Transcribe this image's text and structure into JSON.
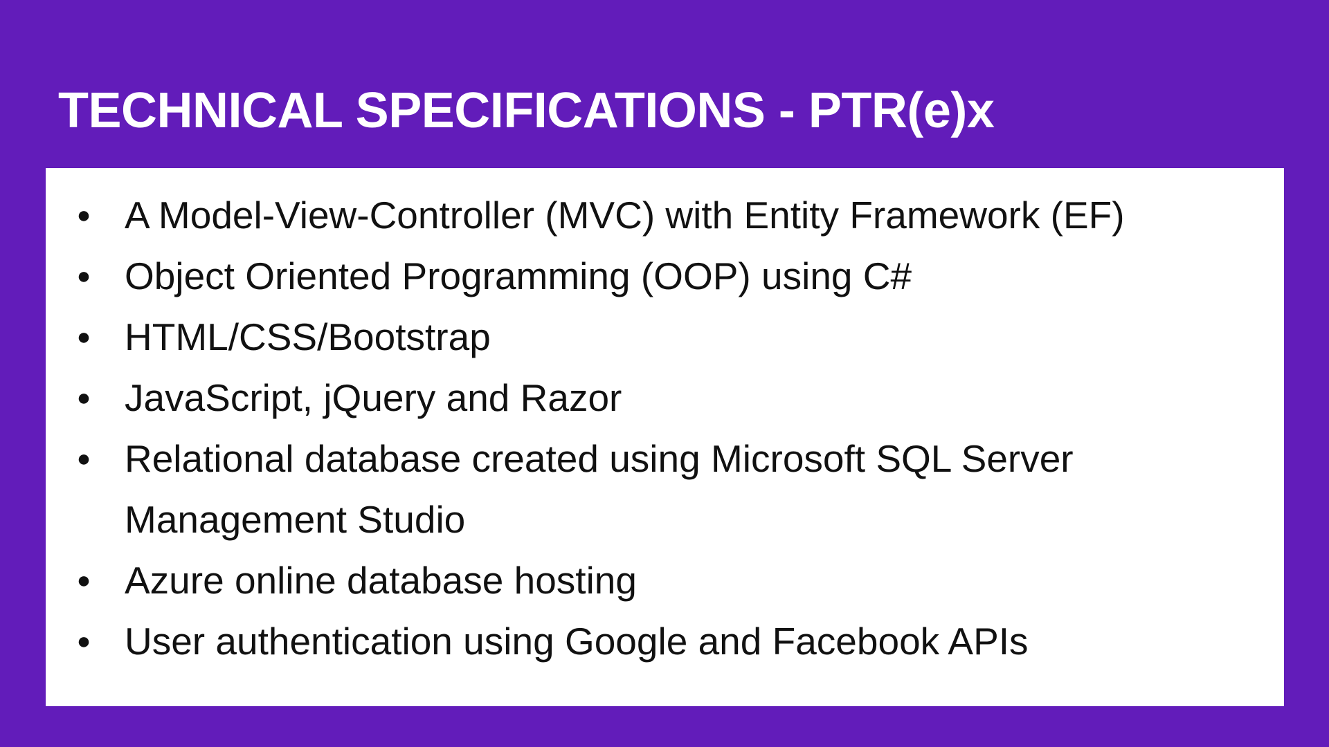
{
  "slide": {
    "title": "TECHNICAL SPECIFICATIONS - PTR(e)x",
    "bullet_glyph": "●",
    "items": [
      {
        "text": "A Model-View-Controller (MVC) with Entity Framework (EF)"
      },
      {
        "text": "Object Oriented Programming (OOP) using C#"
      },
      {
        "text": "HTML/CSS/Bootstrap"
      },
      {
        "text": "JavaScript, jQuery and Razor"
      },
      {
        "text": "Relational database created using Microsoft SQL Server Management Studio"
      },
      {
        "text": "Azure online database hosting"
      },
      {
        "text": "User authentication using Google and Facebook APIs"
      }
    ]
  },
  "colors": {
    "background": "#621cba",
    "panel": "#ffffff",
    "title_text": "#ffffff",
    "body_text": "#111111"
  }
}
